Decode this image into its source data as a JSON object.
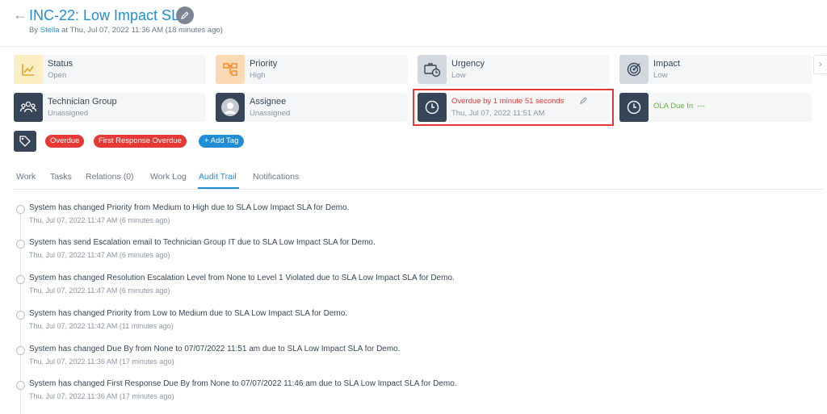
{
  "header": {
    "title": "INC-22: Low Impact SLA",
    "byline_prefix": "By",
    "author": "Stella",
    "byline_suffix": "at Thu, Jul 07, 2022 11:36 AM (18 minutes ago)"
  },
  "cards": {
    "status": {
      "label": "Status",
      "value": "Open",
      "icon": "chart-icon"
    },
    "priority": {
      "label": "Priority",
      "value": "High",
      "icon": "flow-icon"
    },
    "urgency": {
      "label": "Urgency",
      "value": "Low",
      "icon": "briefcase-clock-icon"
    },
    "impact": {
      "label": "Impact",
      "value": "Low",
      "icon": "target-icon"
    },
    "technician_group": {
      "label": "Technician Group",
      "value": "Unassigned",
      "icon": "group-icon"
    },
    "assignee": {
      "label": "Assignee",
      "value": "Unassigned",
      "icon": "avatar-icon"
    }
  },
  "sla": {
    "status": "Overdue by 1 minute 51 seconds",
    "due": "Thu, Jul 07, 2022 11:51 AM",
    "ola_label": "OLA Due In",
    "ola_value": "---"
  },
  "tags": [
    "Overdue",
    "First Response Overdue"
  ],
  "add_tag_label": "+ Add Tag",
  "tabs": [
    "Work",
    "Tasks",
    "Relations (0)",
    "Work Log",
    "Audit Trail",
    "Notifications"
  ],
  "active_tab": "Audit Trail",
  "audit_trail": [
    {
      "text": "System has changed Priority from Medium to High due to SLA Low Impact SLA for Demo.",
      "time": "Thu, Jul 07, 2022 11:47 AM (6 minutes ago)"
    },
    {
      "text": "System has send Escalation email to Technician Group IT due to SLA Low Impact SLA for Demo.",
      "time": "Thu, Jul 07, 2022 11:47 AM (6 minutes ago)"
    },
    {
      "text": "System has changed Resolution Escalation Level from None to Level 1 Violated due to SLA Low Impact SLA for Demo.",
      "time": "Thu, Jul 07, 2022 11:47 AM (6 minutes ago)"
    },
    {
      "text": "System has changed Priority from Low to Medium due to SLA Low Impact SLA for Demo.",
      "time": "Thu, Jul 07, 2022 11:42 AM (11 minutes ago)"
    },
    {
      "text": "System has changed Due By from None to 07/07/2022 11:51 am due to SLA Low Impact SLA for Demo.",
      "time": "Thu, Jul 07, 2022 11:36 AM (17 minutes ago)"
    },
    {
      "text": "System has changed First Response Due By from None to 07/07/2022 11:46 am due to SLA Low Impact SLA for Demo.",
      "time": "Thu, Jul 07, 2022 11:36 AM (17 minutes ago)"
    }
  ],
  "colors": {
    "accent": "#1f8ed4",
    "danger": "#e53935",
    "success": "#5cb82d",
    "dark": "#364658"
  }
}
